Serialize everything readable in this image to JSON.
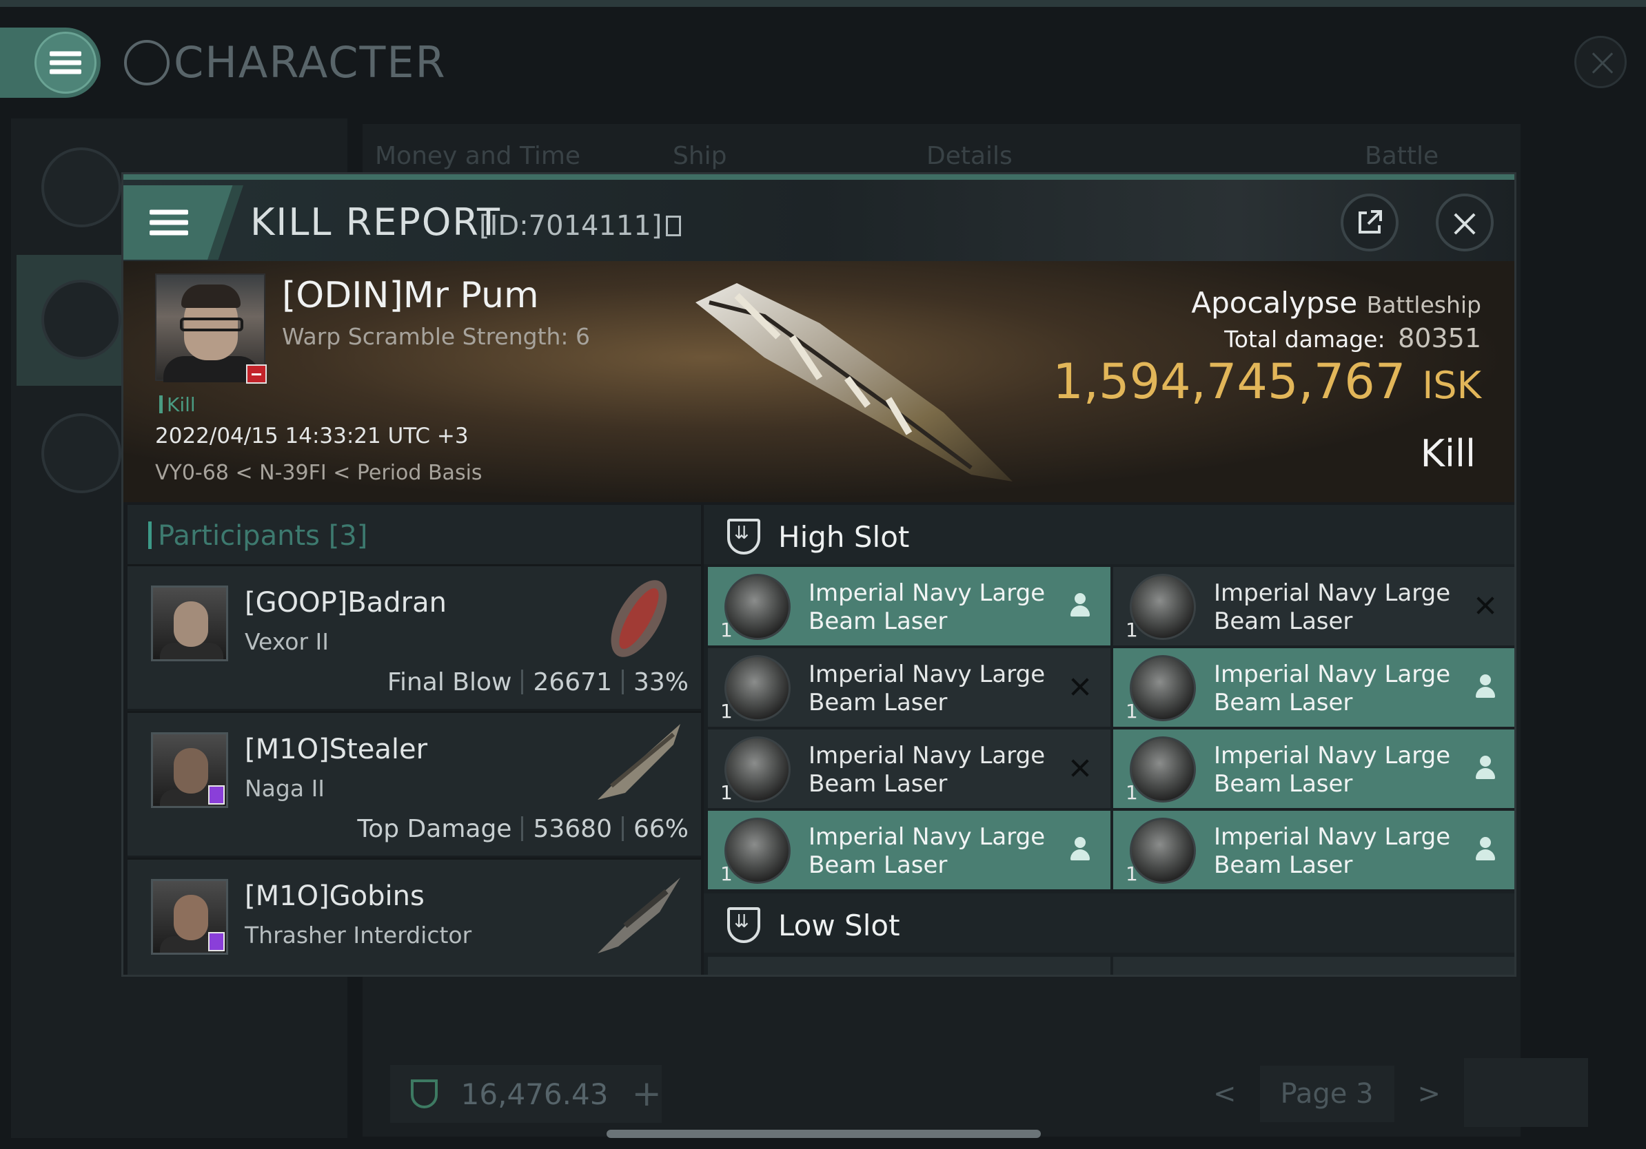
{
  "background_window": {
    "title": "CHARACTER",
    "tabs": [
      "Money and Time",
      "Ship",
      "Details",
      "Battle Status"
    ],
    "wallet_value": "16,476.43",
    "page_label": "Page 3"
  },
  "kill_report": {
    "title": "KILL REPORT",
    "id": "[ID:7014111]",
    "victim": {
      "name": "[ODIN]Mr Pum",
      "warp_scramble": "Warp Scramble Strength: 6",
      "tag": "Kill",
      "datetime": "2022/04/15 14:33:21 UTC +3",
      "location": "VY0-68 < N-39FI < Period Basis",
      "ship": "Apocalypse",
      "ship_class": "Battleship",
      "total_damage_label": "Total damage:",
      "total_damage": "80351",
      "isk_value": "1,594,745,767",
      "isk_unit": "ISK",
      "result": "Kill"
    },
    "participants": {
      "label": "Participants",
      "count": "[3]",
      "rows": [
        {
          "name": "[GOOP]Badran",
          "ship": "Vexor II",
          "role": "Final Blow",
          "damage": "26671",
          "percent": "33%"
        },
        {
          "name": "[M1O]Stealer",
          "ship": "Naga II",
          "role": "Top Damage",
          "damage": "53680",
          "percent": "66%"
        },
        {
          "name": "[M1O]Gobins",
          "ship": "Thrasher Interdictor",
          "role": "",
          "damage": "",
          "percent": ""
        }
      ]
    },
    "high_slot": {
      "label": "High Slot",
      "items": [
        {
          "qty": "1",
          "name": "Imperial Navy Large Beam Laser",
          "status": "dropped"
        },
        {
          "qty": "1",
          "name": "Imperial Navy Large Beam Laser",
          "status": "destroyed"
        },
        {
          "qty": "1",
          "name": "Imperial Navy Large Beam Laser",
          "status": "destroyed"
        },
        {
          "qty": "1",
          "name": "Imperial Navy Large Beam Laser",
          "status": "dropped"
        },
        {
          "qty": "1",
          "name": "Imperial Navy Large Beam Laser",
          "status": "destroyed"
        },
        {
          "qty": "1",
          "name": "Imperial Navy Large Beam Laser",
          "status": "dropped"
        },
        {
          "qty": "1",
          "name": "Imperial Navy Large Beam Laser",
          "status": "dropped"
        },
        {
          "qty": "1",
          "name": "Imperial Navy Large Beam Laser",
          "status": "dropped"
        }
      ]
    },
    "low_slot": {
      "label": "Low Slot"
    }
  },
  "colors": {
    "accent_teal": "#3f6e64",
    "isk_gold": "#e2b659",
    "fitted_item": "#4a7e72"
  }
}
